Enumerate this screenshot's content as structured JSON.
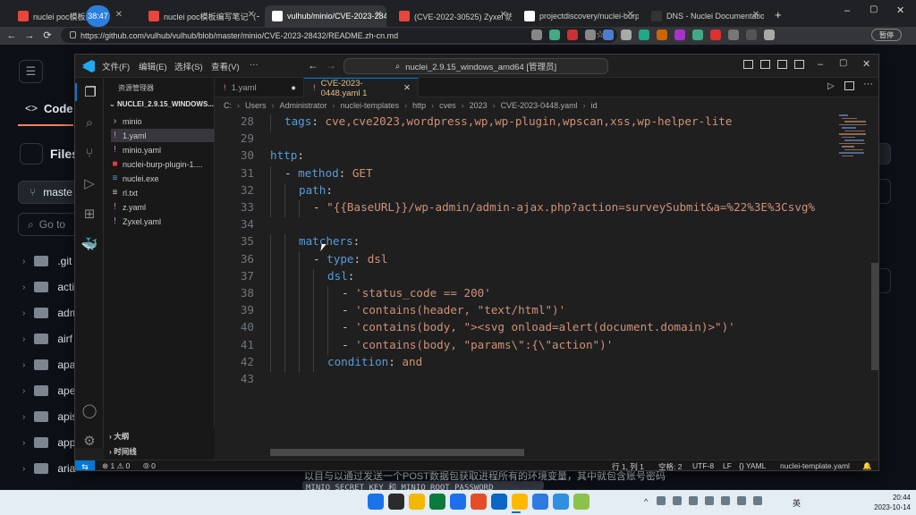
{
  "browser": {
    "timer": "38:47",
    "tabs": [
      {
        "title": "nuclei poc模板编写",
        "color": "#e8453c"
      },
      {
        "title": "nuclei poc模板编写笔记（一）",
        "color": "#e8453c"
      },
      {
        "title": "vulhub/minio/CVE-2023-284",
        "color": "#ffffff"
      },
      {
        "title": "(CVE-2022-30525) Zyxel 防",
        "color": "#e8453c"
      },
      {
        "title": "projectdiscovery/nuclei-burp",
        "color": "#ffffff"
      },
      {
        "title": "DNS - Nuclei Documentation",
        "color": "#333333"
      }
    ],
    "url": "https://github.com/vulhub/vulhub/blob/master/minio/CVE-2023-28432/README.zh-cn.md",
    "profile": "暂停"
  },
  "github": {
    "code_tab": "Code",
    "files_label": "Files",
    "branch": "maste",
    "goto": "Go to",
    "dirs": [
      ".git",
      "acti",
      "adm",
      "airf",
      "apa",
      "ape",
      "apis",
      "app",
      "aria"
    ],
    "below_text": "以目与以通过发送一个POST数据包获取进程所有的环境变量，其中就包含账号密码",
    "below_code": "MINIO_SECRET_KEY 和 MINIO_ROOT_PASSWORD"
  },
  "vscode": {
    "menus": [
      "文件(F)",
      "编辑(E)",
      "选择(S)",
      "查看(V)",
      "···"
    ],
    "command_center": "nuclei_2.9.15_windows_amd64 [管理员]",
    "explorer_title": "资源管理器",
    "root": "NUCLEI_2.9.15_WINDOWS...",
    "files": [
      {
        "name": "minio",
        "icon": "›",
        "color": "#cccccc"
      },
      {
        "name": "1.yaml",
        "icon": "!",
        "color": "#c586c0",
        "selected": true
      },
      {
        "name": "minio.yaml",
        "icon": "!",
        "color": "#c586c0"
      },
      {
        "name": "nuclei-burp-plugin-1....",
        "icon": "■",
        "color": "#e04040"
      },
      {
        "name": "nuclei.exe",
        "icon": "≡",
        "color": "#4ea0d8"
      },
      {
        "name": "rl.txt",
        "icon": "≡",
        "color": "#cccccc"
      },
      {
        "name": "z.yaml",
        "icon": "!",
        "color": "#c586c0"
      },
      {
        "name": "Zyxel.yaml",
        "icon": "!",
        "color": "#c586c0"
      }
    ],
    "outline": "大纲",
    "timeline": "时间线",
    "editor_tabs": [
      {
        "title": "1.yaml",
        "active": false,
        "dirty": true
      },
      {
        "title": "CVE-2023-0448.yaml 1",
        "active": true
      }
    ],
    "breadcrumb": [
      "C:",
      "Users",
      "Administrator",
      "nuclei-templates",
      "http",
      "cves",
      "2023",
      "CVE-2023-0448.yaml",
      "id"
    ],
    "lines": [
      {
        "n": "28",
        "indent": 1,
        "parts": [
          [
            "k",
            "tags"
          ],
          [
            "p",
            ": "
          ],
          [
            "s",
            "cve,cve2023,wordpress,wp,wp-plugin,wpscan,xss,wp-helper-lite"
          ]
        ]
      },
      {
        "n": "29",
        "indent": 0,
        "parts": []
      },
      {
        "n": "30",
        "indent": 0,
        "parts": [
          [
            "k",
            "http"
          ],
          [
            "p",
            ":"
          ]
        ]
      },
      {
        "n": "31",
        "indent": 1,
        "parts": [
          [
            "p",
            "- "
          ],
          [
            "k",
            "method"
          ],
          [
            "p",
            ": "
          ],
          [
            "s",
            "GET"
          ]
        ]
      },
      {
        "n": "32",
        "indent": 2,
        "parts": [
          [
            "k",
            "path"
          ],
          [
            "p",
            ":"
          ]
        ]
      },
      {
        "n": "33",
        "indent": 3,
        "parts": [
          [
            "p",
            "- "
          ],
          [
            "s",
            "\"{{BaseURL}}/wp-admin/admin-ajax.php?action=surveySubmit&a=%22%3E%3Csvg%"
          ]
        ]
      },
      {
        "n": "34",
        "indent": 0,
        "parts": []
      },
      {
        "n": "35",
        "indent": 2,
        "parts": [
          [
            "k",
            "matchers"
          ],
          [
            "p",
            ":"
          ]
        ]
      },
      {
        "n": "36",
        "indent": 3,
        "parts": [
          [
            "p",
            "- "
          ],
          [
            "k",
            "type"
          ],
          [
            "p",
            ": "
          ],
          [
            "s",
            "dsl"
          ]
        ]
      },
      {
        "n": "37",
        "indent": 4,
        "parts": [
          [
            "k",
            "dsl"
          ],
          [
            "p",
            ":"
          ]
        ]
      },
      {
        "n": "38",
        "indent": 5,
        "parts": [
          [
            "p",
            "- "
          ],
          [
            "s",
            "'status_code == 200'"
          ]
        ]
      },
      {
        "n": "39",
        "indent": 5,
        "parts": [
          [
            "p",
            "- "
          ],
          [
            "s",
            "'contains(header, \"text/html\")'"
          ]
        ]
      },
      {
        "n": "40",
        "indent": 5,
        "parts": [
          [
            "p",
            "- "
          ],
          [
            "s",
            "'contains(body, \"><svg onload=alert(document.domain)>\")'"
          ]
        ]
      },
      {
        "n": "41",
        "indent": 5,
        "parts": [
          [
            "p",
            "- "
          ],
          [
            "s",
            "'contains(body, \"params\\\":{\\\"action\")'"
          ]
        ]
      },
      {
        "n": "42",
        "indent": 4,
        "parts": [
          [
            "k",
            "condition"
          ],
          [
            "p",
            ": "
          ],
          [
            "s",
            "and"
          ]
        ]
      },
      {
        "n": "43",
        "indent": 0,
        "parts": []
      }
    ],
    "status": {
      "errors": "⊗ 1 ⚠ 0",
      "ports": "⦾ 0",
      "position": "行 1, 列 1",
      "spaces": "空格: 2",
      "encoding": "UTF-8",
      "eol": "LF",
      "language": "{} YAML",
      "schema": "nuclei-template.yaml"
    }
  },
  "taskbar": {
    "lang": "英",
    "time": "20:44",
    "date": "2023-10-14"
  }
}
